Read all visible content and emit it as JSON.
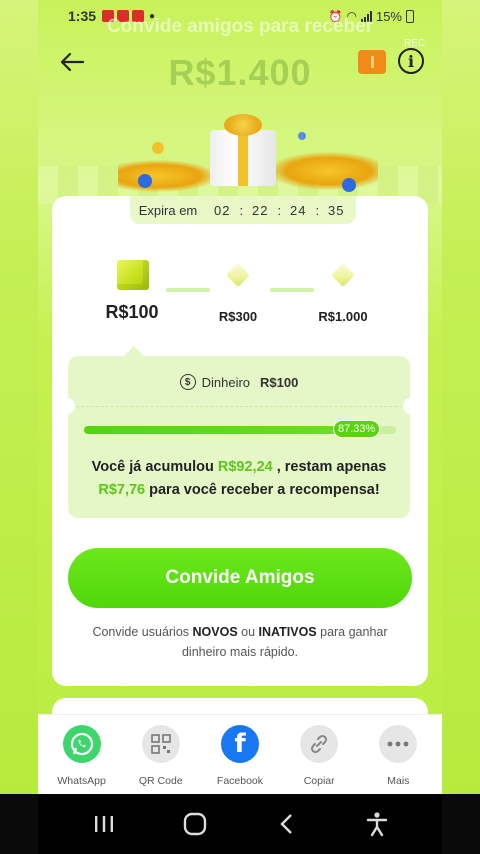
{
  "status_bar": {
    "time": "1:35",
    "battery": "15%"
  },
  "header": {
    "overlay_title": "Convide amigos para receber",
    "amount": "R$1.400",
    "rec_label": "REC"
  },
  "timer": {
    "label": "Expira em",
    "hours": "02",
    "minutes": "22",
    "seconds": "24",
    "centis": "35"
  },
  "milestones": [
    {
      "amount": "R$100"
    },
    {
      "amount": "R$300"
    },
    {
      "amount": "R$1.000"
    }
  ],
  "reward": {
    "cash_label": "Dinheiro",
    "cash_amount": "R$100",
    "progress": 87.33,
    "progress_label": "87.33%",
    "msg_part1": "Você já acumulou ",
    "accumulated": "R$92,24",
    "msg_part2": " , restam apenas ",
    "remaining": "R$7,76",
    "msg_part3": " para você receber a recompensa!"
  },
  "invite_button": "Convide Amigos",
  "hint": {
    "part1": "Convide usuários ",
    "bold1": "NOVOS",
    "part2": " ou ",
    "bold2": "INATIVOS",
    "part3": " para ganhar dinheiro mais rápido."
  },
  "share": [
    {
      "label": "WhatsApp",
      "icon": "whatsapp-icon"
    },
    {
      "label": "QR Code",
      "icon": "qr-code-icon"
    },
    {
      "label": "Facebook",
      "icon": "facebook-icon"
    },
    {
      "label": "Copiar",
      "icon": "link-icon"
    },
    {
      "label": "Mais",
      "icon": "more-icon"
    }
  ],
  "colors": {
    "accent": "#57d40d",
    "highlight": "#5cc61a",
    "background": "#c6f050"
  }
}
